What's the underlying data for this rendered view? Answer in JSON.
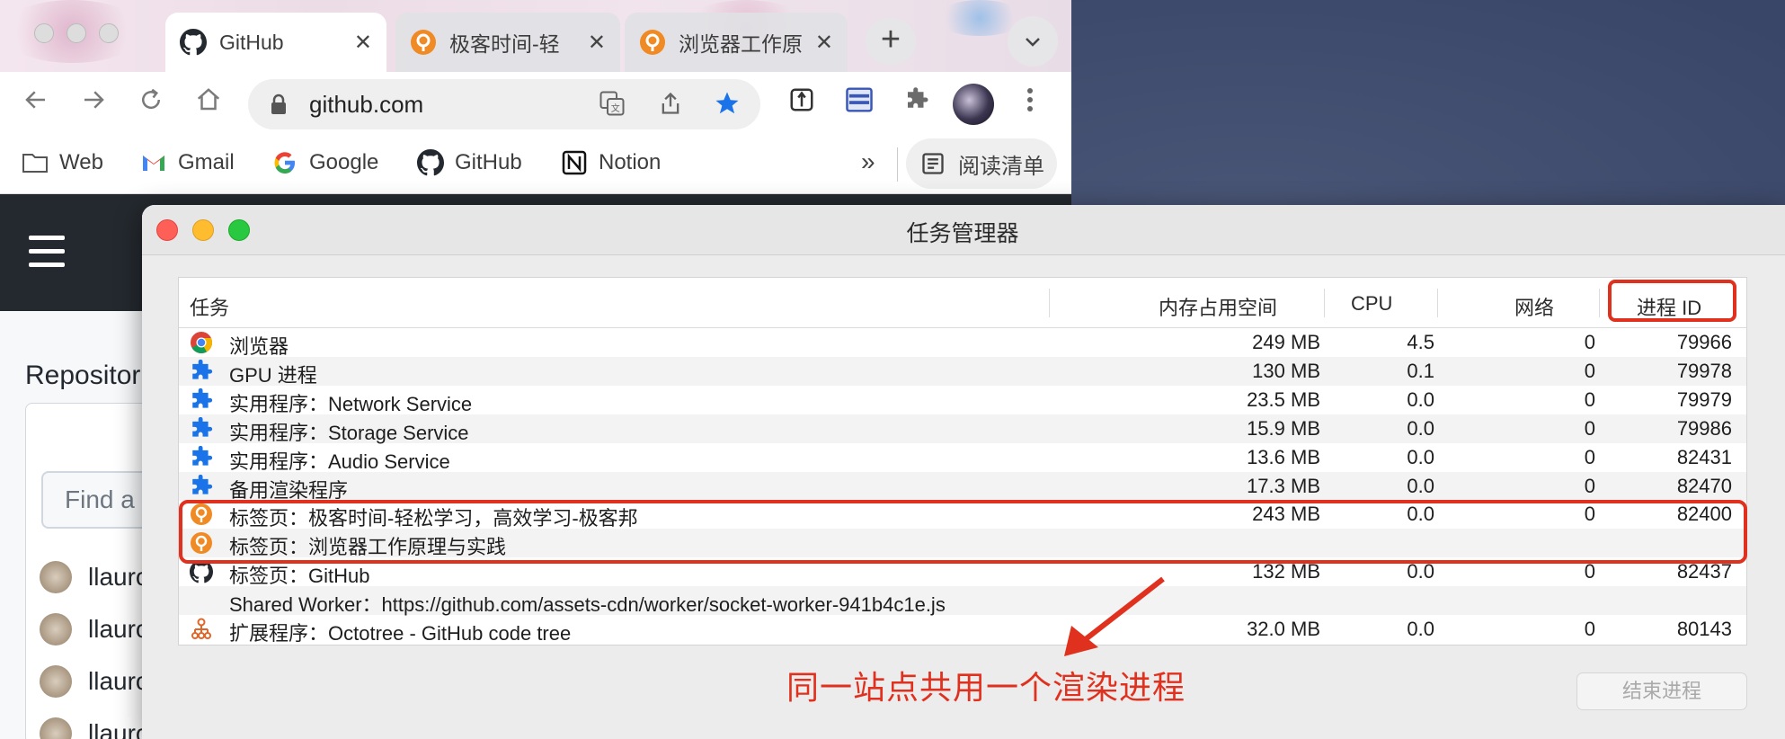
{
  "browser": {
    "tabs": [
      {
        "label": "GitHub",
        "icon": "github-icon",
        "active": true
      },
      {
        "label": "极客时间-轻",
        "icon": "geektime-icon",
        "active": false
      },
      {
        "label": "浏览器工作原",
        "icon": "geektime-icon",
        "active": false
      }
    ],
    "close_glyph": "✕",
    "new_tab_glyph": "+",
    "tab_menu_glyph": "⌄",
    "url": "github.com",
    "bookmarks": [
      {
        "label": "Web",
        "icon": "folder-icon"
      },
      {
        "label": "Gmail",
        "icon": "gmail-icon"
      },
      {
        "label": "Google",
        "icon": "google-icon"
      },
      {
        "label": "GitHub",
        "icon": "github-icon"
      },
      {
        "label": "Notion",
        "icon": "notion-icon"
      }
    ],
    "bookmarks_more": "»",
    "reading_list": "阅读清单"
  },
  "github_page": {
    "repositories_label": "Repositor",
    "find_placeholder": "Find a",
    "list_items": [
      "llauro",
      "llauro",
      "llauro",
      "llauro"
    ]
  },
  "task_manager": {
    "title": "任务管理器",
    "columns": {
      "task": "任务",
      "memory": "内存占用空间",
      "cpu": "CPU",
      "network": "网络",
      "pid": "进程 ID"
    },
    "rows": [
      {
        "icon": "chrome-icon",
        "name": "浏览器",
        "memory": "249 MB",
        "cpu": "4.5",
        "network": "0",
        "pid": "79966"
      },
      {
        "icon": "puzzle-icon",
        "name": "GPU 进程",
        "memory": "130 MB",
        "cpu": "0.1",
        "network": "0",
        "pid": "79978"
      },
      {
        "icon": "puzzle-icon",
        "name": "实用程序：Network Service",
        "memory": "23.5 MB",
        "cpu": "0.0",
        "network": "0",
        "pid": "79979"
      },
      {
        "icon": "puzzle-icon",
        "name": "实用程序：Storage Service",
        "memory": "15.9 MB",
        "cpu": "0.0",
        "network": "0",
        "pid": "79986"
      },
      {
        "icon": "puzzle-icon",
        "name": "实用程序：Audio Service",
        "memory": "13.6 MB",
        "cpu": "0.0",
        "network": "0",
        "pid": "82431"
      },
      {
        "icon": "puzzle-icon",
        "name": "备用渲染程序",
        "memory": "17.3 MB",
        "cpu": "0.0",
        "network": "0",
        "pid": "82470"
      },
      {
        "icon": "geektime-icon",
        "name": "标签页：极客时间-轻松学习，高效学习-极客邦",
        "memory": "243 MB",
        "cpu": "0.0",
        "network": "0",
        "pid": "82400"
      },
      {
        "icon": "geektime-icon",
        "name": "标签页：浏览器工作原理与实践",
        "memory": "",
        "cpu": "",
        "network": "",
        "pid": ""
      },
      {
        "icon": "github-icon",
        "name": "标签页：GitHub",
        "memory": "132 MB",
        "cpu": "0.0",
        "network": "0",
        "pid": "82437"
      },
      {
        "icon": "",
        "name": "Shared Worker：https://github.com/assets-cdn/worker/socket-worker-941b4c1e.js",
        "memory": "",
        "cpu": "",
        "network": "",
        "pid": ""
      },
      {
        "icon": "octotree-icon",
        "name": "扩展程序：Octotree - GitHub code tree",
        "memory": "32.0 MB",
        "cpu": "0.0",
        "network": "0",
        "pid": "80143"
      }
    ],
    "end_process_button": "结束进程"
  },
  "annotation": {
    "text": "同一站点共用一个渲染进程",
    "color": "#e0301e"
  },
  "colors": {
    "github_dark": "#24292f",
    "geektime_orange": "#f08a24",
    "chrome_blue": "#1a73e8"
  }
}
